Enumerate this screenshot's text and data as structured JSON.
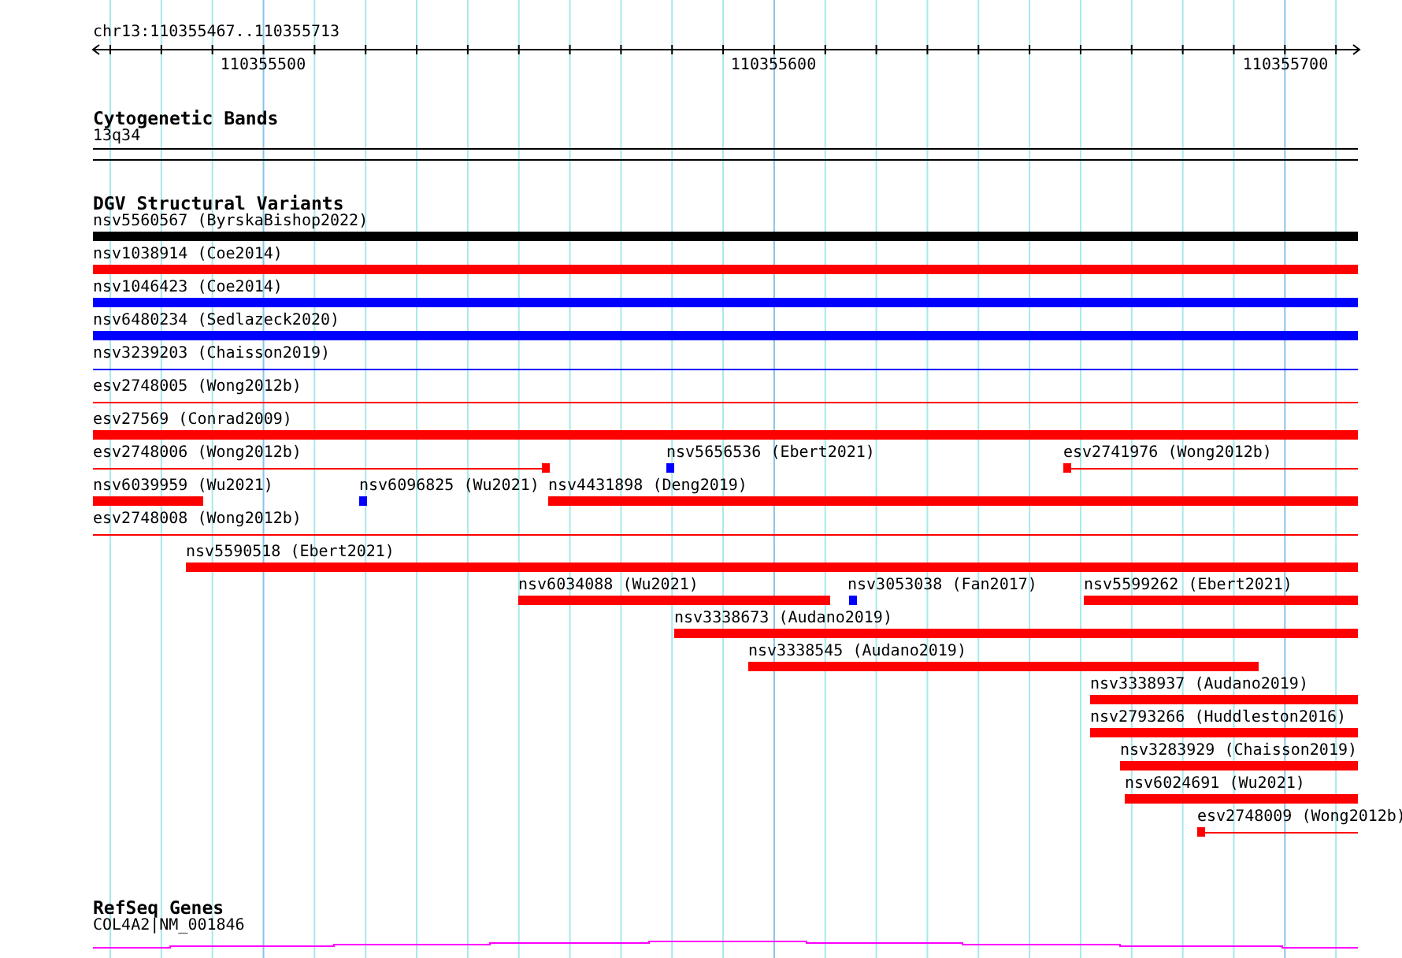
{
  "location": "chr13:110355467..110355713",
  "ruler": {
    "ticks": [
      "110355500",
      "110355600",
      "110355700"
    ]
  },
  "cytogenetic_bands": {
    "title": "Cytogenetic Bands",
    "band": "13q34"
  },
  "dgv": {
    "title": "DGV Structural Variants",
    "rows": [
      {
        "features": [
          {
            "label": "nsv5560567 (ByrskaBishop2022)",
            "kind": "bar",
            "color": "#000000"
          }
        ]
      },
      {
        "features": [
          {
            "label": "nsv1038914 (Coe2014)",
            "kind": "bar",
            "color": "#ff0000"
          }
        ]
      },
      {
        "features": [
          {
            "label": "nsv1046423 (Coe2014)",
            "kind": "bar",
            "color": "#0000ff"
          }
        ]
      },
      {
        "features": [
          {
            "label": "nsv6480234 (Sedlazeck2020)",
            "kind": "bar",
            "color": "#0000ff"
          }
        ]
      },
      {
        "features": [
          {
            "label": "nsv3239203 (Chaisson2019)",
            "kind": "line",
            "color": "#0000ff"
          }
        ]
      },
      {
        "features": [
          {
            "label": "esv2748005 (Wong2012b)",
            "kind": "line",
            "color": "#ff0000"
          }
        ]
      },
      {
        "features": [
          {
            "label": "esv27569 (Conrad2009)",
            "kind": "bar",
            "color": "#ff0000"
          }
        ]
      },
      {
        "features": [
          {
            "label": "esv2748006 (Wong2012b)",
            "kind": "line",
            "color": "#ff0000"
          },
          {
            "label": "nsv5656536 (Ebert2021)",
            "kind": "point",
            "color": "#0000ff"
          },
          {
            "label": "esv2741976 (Wong2012b)",
            "kind": "line",
            "color": "#ff0000"
          }
        ]
      },
      {
        "features": [
          {
            "label": "nsv6039959 (Wu2021)",
            "kind": "bar",
            "color": "#ff0000"
          },
          {
            "label": "nsv6096825 (Wu2021)",
            "kind": "point",
            "color": "#0000ff"
          },
          {
            "label": "nsv4431898 (Deng2019)",
            "kind": "bar",
            "color": "#ff0000"
          }
        ]
      },
      {
        "features": [
          {
            "label": "esv2748008 (Wong2012b)",
            "kind": "line",
            "color": "#ff0000"
          }
        ]
      },
      {
        "features": [
          {
            "label": "nsv5590518 (Ebert2021)",
            "kind": "bar",
            "color": "#ff0000"
          }
        ]
      },
      {
        "features": [
          {
            "label": "nsv6034088 (Wu2021)",
            "kind": "bar",
            "color": "#ff0000"
          },
          {
            "label": "nsv3053038 (Fan2017)",
            "kind": "point",
            "color": "#0000ff"
          },
          {
            "label": "nsv5599262 (Ebert2021)",
            "kind": "bar",
            "color": "#ff0000"
          }
        ]
      },
      {
        "features": [
          {
            "label": "nsv3338673 (Audano2019)",
            "kind": "bar",
            "color": "#ff0000"
          }
        ]
      },
      {
        "features": [
          {
            "label": "nsv3338545 (Audano2019)",
            "kind": "bar",
            "color": "#ff0000"
          }
        ]
      },
      {
        "features": [
          {
            "label": "nsv3338937 (Audano2019)",
            "kind": "bar",
            "color": "#ff0000"
          }
        ]
      },
      {
        "features": [
          {
            "label": "nsv2793266 (Huddleston2016)",
            "kind": "bar",
            "color": "#ff0000"
          }
        ]
      },
      {
        "features": [
          {
            "label": "nsv3283929 (Chaisson2019)",
            "kind": "bar",
            "color": "#ff0000"
          }
        ]
      },
      {
        "features": [
          {
            "label": "nsv6024691 (Wu2021)",
            "kind": "bar",
            "color": "#ff0000"
          }
        ]
      },
      {
        "features": [
          {
            "label": "esv2748009 (Wong2012b)",
            "kind": "line",
            "color": "#ff0000"
          }
        ]
      }
    ]
  },
  "refseq": {
    "title": "RefSeq Genes",
    "gene": "COL4A2|NM_001846"
  }
}
